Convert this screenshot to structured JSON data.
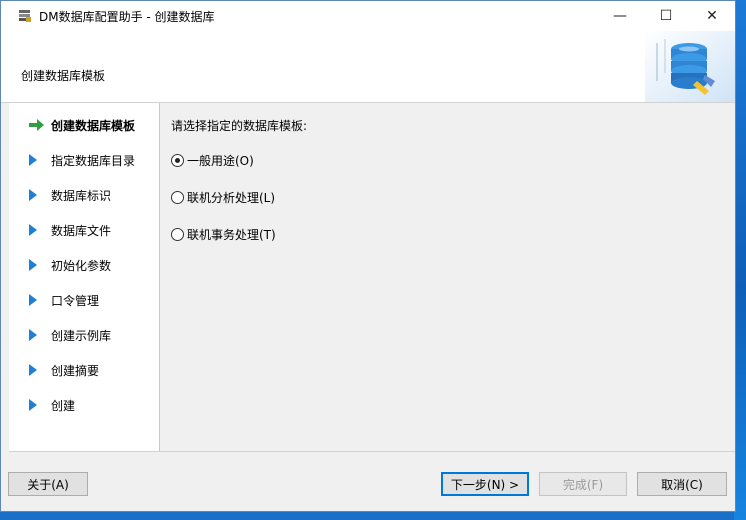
{
  "window": {
    "title": "DM数据库配置助手 - 创建数据库",
    "controls": {
      "minimize": "—",
      "maximize": "☐",
      "close": "✕"
    }
  },
  "header": {
    "title": "创建数据库模板",
    "graphic_icon": "database-wrench-icon"
  },
  "nav": {
    "items": [
      {
        "label": "创建数据库模板",
        "active": true,
        "marker": "green-arrow-icon"
      },
      {
        "label": "指定数据库目录",
        "active": false,
        "marker": "blue-triangle-icon"
      },
      {
        "label": "数据库标识",
        "active": false,
        "marker": "blue-triangle-icon"
      },
      {
        "label": "数据库文件",
        "active": false,
        "marker": "blue-triangle-icon"
      },
      {
        "label": "初始化参数",
        "active": false,
        "marker": "blue-triangle-icon"
      },
      {
        "label": "口令管理",
        "active": false,
        "marker": "blue-triangle-icon"
      },
      {
        "label": "创建示例库",
        "active": false,
        "marker": "blue-triangle-icon"
      },
      {
        "label": "创建摘要",
        "active": false,
        "marker": "blue-triangle-icon"
      },
      {
        "label": "创建",
        "active": false,
        "marker": "blue-triangle-icon"
      }
    ]
  },
  "main": {
    "prompt": "请选择指定的数据库模板:",
    "options": [
      {
        "label": "一般用途(O)",
        "checked": true
      },
      {
        "label": "联机分析处理(L)",
        "checked": false
      },
      {
        "label": "联机事务处理(T)",
        "checked": false
      }
    ]
  },
  "footer": {
    "about": "关于(A)",
    "next": "下一步(N) >",
    "finish": "完成(F)",
    "cancel": "取消(C)"
  },
  "colors": {
    "accent": "#0078d7",
    "nav_triangle": "#1f7fd6",
    "nav_arrow": "#2ea043"
  }
}
